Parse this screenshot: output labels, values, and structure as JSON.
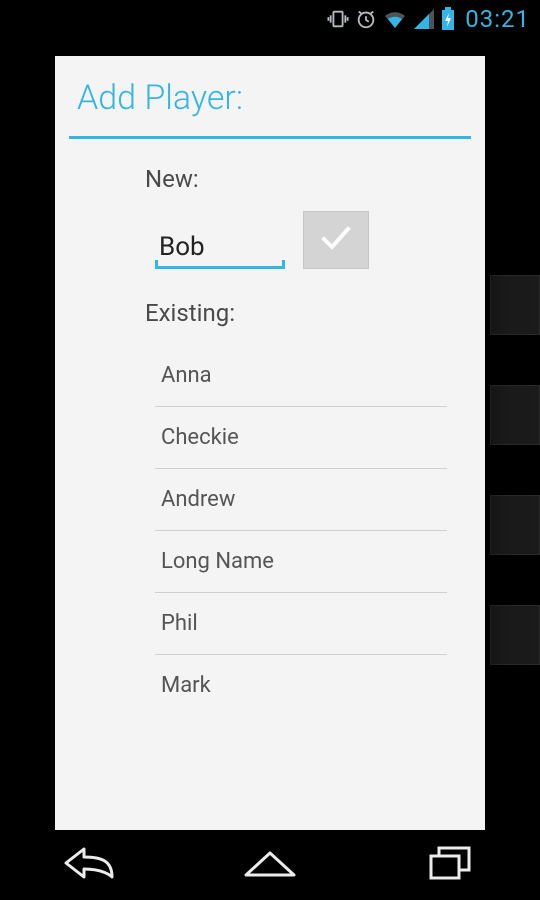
{
  "status": {
    "time": "03:21"
  },
  "dialog": {
    "title": "Add Player:",
    "new_label": "New:",
    "existing_label": "Existing:",
    "name_value": "Bob",
    "players": [
      "Anna",
      "Checkie",
      "Andrew",
      "Long Name",
      "Phil",
      "Mark"
    ]
  },
  "colors": {
    "accent": "#33b5e5"
  }
}
